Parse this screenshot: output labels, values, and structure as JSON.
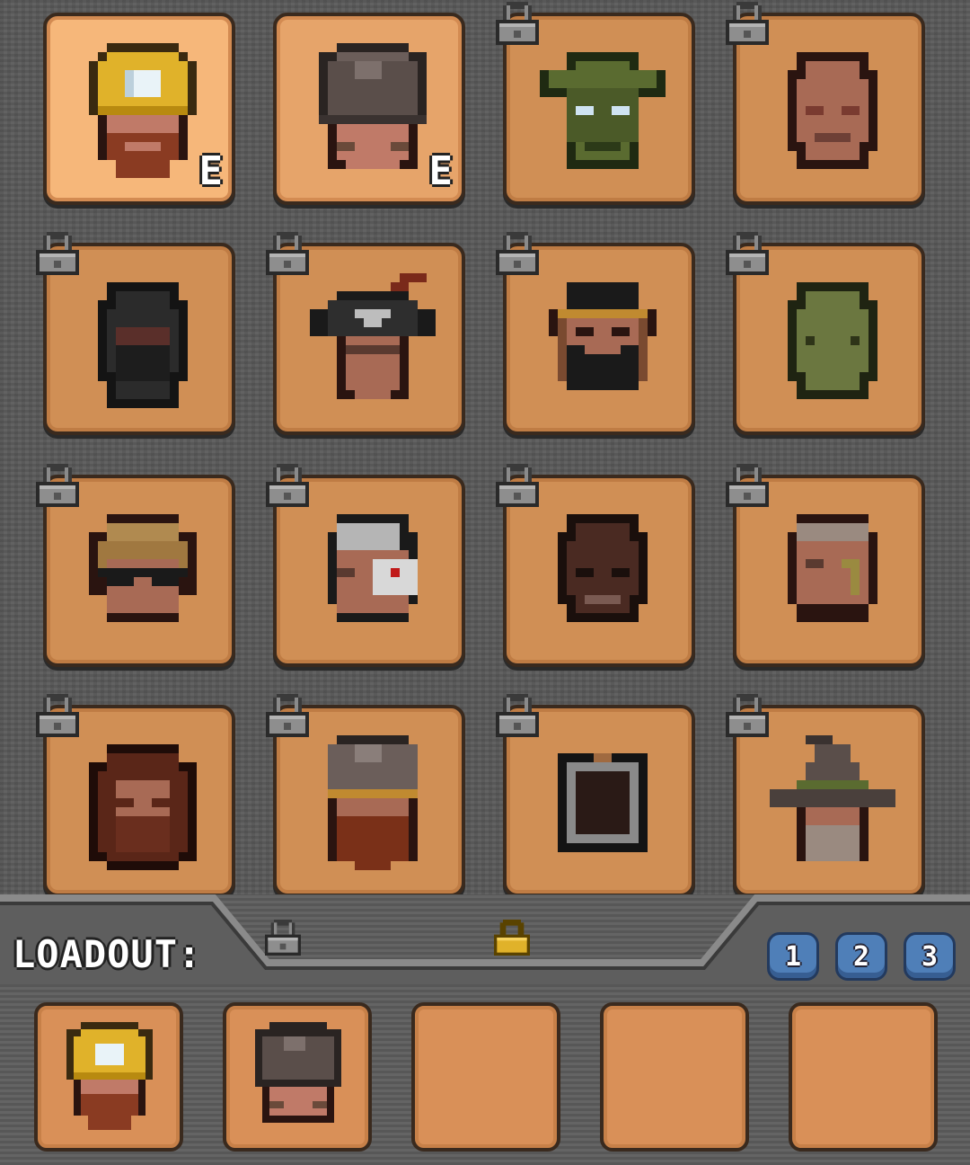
{
  "grid": {
    "slots": [
      {
        "character": "miner",
        "state": "equipped",
        "badge": "E",
        "selected": true
      },
      {
        "character": "helmet-soldier",
        "state": "equipped",
        "badge": "E"
      },
      {
        "character": "goblin",
        "state": "locked"
      },
      {
        "character": "bald-man",
        "state": "locked"
      },
      {
        "character": "hooded-ninja",
        "state": "locked"
      },
      {
        "character": "pirate",
        "state": "locked"
      },
      {
        "character": "bandana-bearded",
        "state": "locked"
      },
      {
        "character": "green-blob",
        "state": "locked"
      },
      {
        "character": "sunglasses-guy",
        "state": "locked"
      },
      {
        "character": "cyborg",
        "state": "locked"
      },
      {
        "character": "dark-skin-man",
        "state": "locked"
      },
      {
        "character": "scarred-man",
        "state": "locked"
      },
      {
        "character": "long-hair-bearded",
        "state": "locked"
      },
      {
        "character": "viking",
        "state": "locked"
      },
      {
        "character": "diver-helmet",
        "state": "locked"
      },
      {
        "character": "wizard",
        "state": "locked"
      }
    ]
  },
  "loadout": {
    "label": "LOADOUT:",
    "presets": [
      "1",
      "2",
      "3"
    ],
    "slots": [
      {
        "character": "miner"
      },
      {
        "character": "helmet-soldier"
      },
      {
        "character": ""
      },
      {
        "character": ""
      },
      {
        "character": ""
      }
    ]
  },
  "icons": {
    "lock": "padlock-icon",
    "unlock": "open-padlock-icon"
  },
  "colors": {
    "slot": "#d08f55",
    "background": "#5a5a5a",
    "preset_button": "#4f7fb8"
  }
}
